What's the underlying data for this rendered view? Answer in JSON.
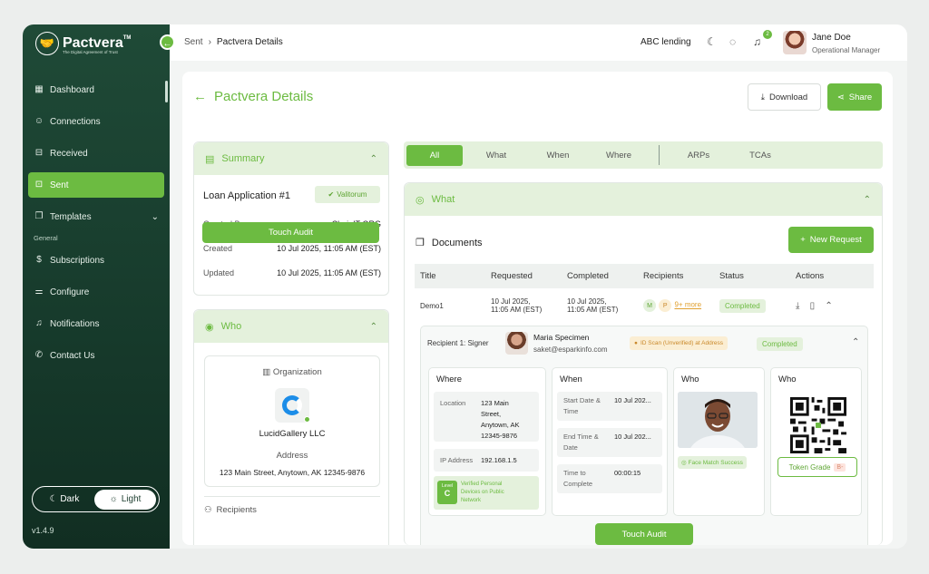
{
  "brand": {
    "name": "Pactvera",
    "tm": "TM",
    "tagline": "The Digital Agreement of Trust"
  },
  "sidebar": {
    "items": [
      {
        "label": "Dashboard",
        "icon": "grid-icon"
      },
      {
        "label": "Connections",
        "icon": "contact-icon"
      },
      {
        "label": "Received",
        "icon": "inbox-icon"
      },
      {
        "label": "Sent",
        "icon": "send-icon",
        "active": true
      },
      {
        "label": "Templates",
        "icon": "document-icon"
      }
    ],
    "section": "General",
    "general_items": [
      {
        "label": "Subscriptions",
        "icon": "dollar-icon"
      },
      {
        "label": "Configure",
        "icon": "sliders-icon"
      },
      {
        "label": "Notifications",
        "icon": "bell-icon"
      },
      {
        "label": "Contact Us",
        "icon": "phone-icon"
      }
    ],
    "theme": {
      "dark": "Dark",
      "light": "Light",
      "selected": "Light"
    },
    "version": "v1.4.9"
  },
  "topbar": {
    "breadcrumb": [
      "Sent",
      "Pactvera Details"
    ],
    "org": "ABC lending",
    "notification_count": "2",
    "user": {
      "name": "Jane Doe",
      "role": "Operational Manager"
    }
  },
  "page": {
    "title": "Pactvera Details",
    "download": "Download",
    "share": "Share"
  },
  "summary": {
    "header": "Summary",
    "loan_title": "Loan Application #1",
    "badge": "Valitorum",
    "fields": [
      {
        "k": "Created By",
        "v": "ChainIT ORG"
      },
      {
        "k": "Created",
        "v": "10 Jul 2025, 11:05 AM (EST)"
      },
      {
        "k": "Updated",
        "v": "10 Jul 2025, 11:05 AM (EST)"
      }
    ],
    "touch_audit": "Touch Audit"
  },
  "who": {
    "header": "Who",
    "org_label": "Organization",
    "org_name": "LucidGallery LLC",
    "address_label": "Address",
    "address": "123 Main Street, Anytown, AK 12345-9876",
    "recipients_label": "Recipients"
  },
  "tabs": [
    "All",
    "What",
    "When",
    "Where",
    "ARPs",
    "TCAs"
  ],
  "what": {
    "header": "What",
    "documents": "Documents",
    "new_request": "New Request",
    "columns": [
      "Title",
      "Requested",
      "Completed",
      "Recipients",
      "Status",
      "Actions"
    ],
    "row": {
      "title": "Demo1",
      "requested": [
        "10 Jul 2025,",
        "11:05 AM (EST)"
      ],
      "completed": [
        "10 Jul 2025,",
        "11:05 AM (EST)"
      ],
      "chips": [
        "M",
        "P"
      ],
      "more": "9+ more",
      "status": "Completed"
    }
  },
  "recipient": {
    "label": "Recipient 1: Signer",
    "name": "Maria Specimen",
    "email": "saket@esparkinfo.com",
    "scan": "ID Scan (Unverified) at Address",
    "status": "Completed",
    "where": {
      "title": "Where",
      "location_k": "Location",
      "location_v": [
        "123 Main",
        "Street,",
        "Anytown, AK",
        "12345-9876"
      ],
      "ip_k": "IP Address",
      "ip_v": "192.168.1.5",
      "level_label": "Level",
      "level": "C",
      "verified": [
        "Verified Personal",
        "Devices on Public",
        "Network"
      ]
    },
    "when": {
      "title": "When",
      "start_k": [
        "Start Date &",
        "Time"
      ],
      "start_v": "10 Jul 202...",
      "end_k": [
        "End Time &",
        "Date"
      ],
      "end_v": "10 Jul 202...",
      "ttc_k": [
        "Time to",
        "Complete"
      ],
      "ttc_v": "00:00:15"
    },
    "who_photo": {
      "title": "Who",
      "face_match": "Face Match Success"
    },
    "who_qr": {
      "title": "Who",
      "token_label": "Token Grade",
      "token_grade": "B-"
    },
    "touch_audit": "Touch Audit"
  },
  "colors": {
    "accent": "#6cbb41",
    "sidebar": "#1f4a37",
    "accent_light": "#e4f1dc"
  }
}
